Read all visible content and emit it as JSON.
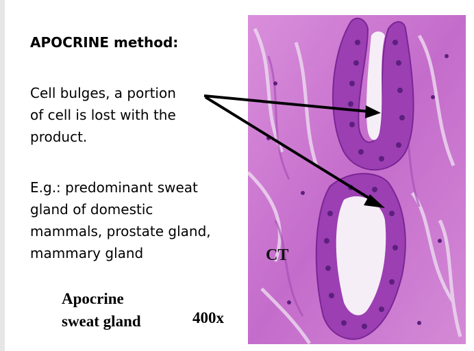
{
  "slide": {
    "title": "APOCRINE method:",
    "paragraph1": [
      "Cell bulges, a portion",
      "of cell is lost with the",
      "product."
    ],
    "paragraph2": [
      "E.g.: predominant sweat",
      "gland of domestic",
      "mammals,  prostate gland,",
      "mammary gland"
    ],
    "caption": [
      "Apocrine",
      "sweat gland"
    ],
    "magnification": "400x",
    "image_label": "CT"
  },
  "colors": {
    "stain_background": "#c96fcf",
    "nuclei": "#5c1f7e",
    "lumen": "#f6eef7",
    "arrow": "#000000"
  }
}
